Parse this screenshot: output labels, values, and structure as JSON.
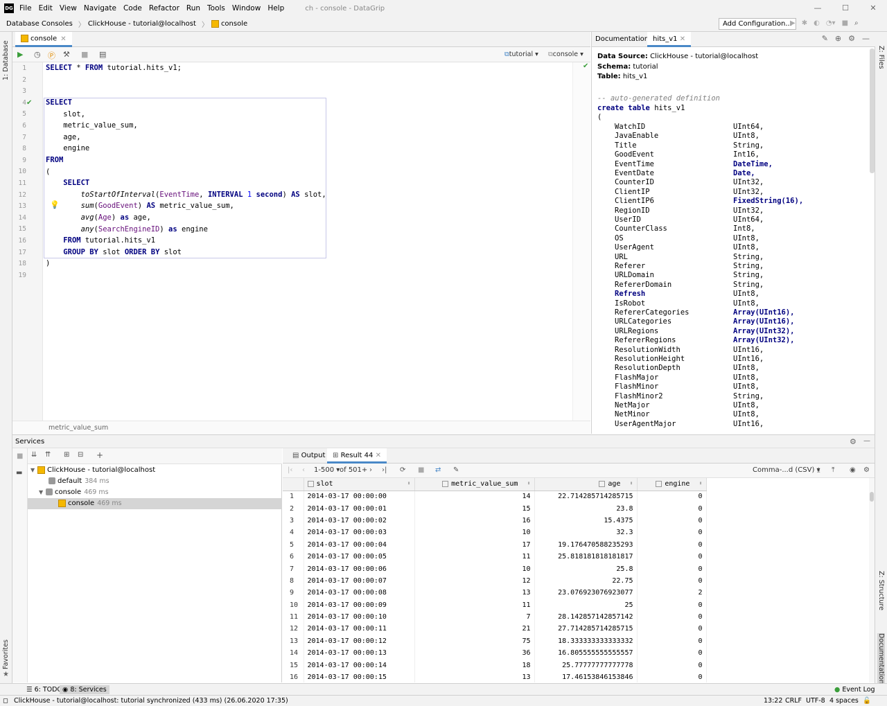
{
  "titlebar": {
    "logo": "DG",
    "menu": [
      "File",
      "Edit",
      "View",
      "Navigate",
      "Code",
      "Refactor",
      "Run",
      "Tools",
      "Window",
      "Help"
    ],
    "title": "ch - console - DataGrip"
  },
  "navbar": {
    "crumbs": [
      "Database Consoles",
      "ClickHouse - tutorial@localhost",
      "console"
    ],
    "add_config": "Add Configuration..."
  },
  "left_strip": {
    "database": "1: Database",
    "favorites": "Favorites"
  },
  "right_strip": {
    "files": "Z: Files",
    "structure": "Z: Structure",
    "documentation": "Documentation"
  },
  "editor": {
    "tab": "console",
    "schema_selector": "tutorial",
    "console_selector": "console",
    "footer": "metric_value_sum",
    "line_numbers": [
      "1",
      "2",
      "3",
      "4",
      "5",
      "6",
      "7",
      "8",
      "9",
      "10",
      "11",
      "12",
      "13",
      "14",
      "15",
      "16",
      "17",
      "18",
      "19"
    ]
  },
  "documentation": {
    "label": "Documentation:",
    "tab": "hits_v1",
    "data_source_label": "Data Source:",
    "data_source": "ClickHouse - tutorial@localhost",
    "schema_label": "Schema:",
    "schema": "tutorial",
    "table_label": "Table:",
    "table": "hits_v1",
    "comment": "-- auto-generated definition",
    "create_kw": "create table",
    "create_name": "hits_v1",
    "open_paren": "(",
    "columns": [
      {
        "name": "WatchID",
        "type": "UInt64,"
      },
      {
        "name": "JavaEnable",
        "type": "UInt8,"
      },
      {
        "name": "Title",
        "type": "String,"
      },
      {
        "name": "GoodEvent",
        "type": "Int16,"
      },
      {
        "name": "EventTime",
        "type": "DateTime,",
        "kw": true
      },
      {
        "name": "EventDate",
        "type": "Date,",
        "kw": true
      },
      {
        "name": "CounterID",
        "type": "UInt32,"
      },
      {
        "name": "ClientIP",
        "type": "UInt32,"
      },
      {
        "name": "ClientIP6",
        "type": "FixedString(16),",
        "kw": true
      },
      {
        "name": "RegionID",
        "type": "UInt32,"
      },
      {
        "name": "UserID",
        "type": "UInt64,"
      },
      {
        "name": "CounterClass",
        "type": "Int8,"
      },
      {
        "name": "OS",
        "type": "UInt8,"
      },
      {
        "name": "UserAgent",
        "type": "UInt8,"
      },
      {
        "name": "URL",
        "type": "String,"
      },
      {
        "name": "Referer",
        "type": "String,"
      },
      {
        "name": "URLDomain",
        "type": "String,"
      },
      {
        "name": "RefererDomain",
        "type": "String,"
      },
      {
        "name": "Refresh",
        "type": "UInt8,",
        "namekw": true
      },
      {
        "name": "IsRobot",
        "type": "UInt8,"
      },
      {
        "name": "RefererCategories",
        "type": "Array(UInt16),",
        "kw": true
      },
      {
        "name": "URLCategories",
        "type": "Array(UInt16),",
        "kw": true
      },
      {
        "name": "URLRegions",
        "type": "Array(UInt32),",
        "kw": true
      },
      {
        "name": "RefererRegions",
        "type": "Array(UInt32),",
        "kw": true
      },
      {
        "name": "ResolutionWidth",
        "type": "UInt16,"
      },
      {
        "name": "ResolutionHeight",
        "type": "UInt16,"
      },
      {
        "name": "ResolutionDepth",
        "type": "UInt8,"
      },
      {
        "name": "FlashMajor",
        "type": "UInt8,"
      },
      {
        "name": "FlashMinor",
        "type": "UInt8,"
      },
      {
        "name": "FlashMinor2",
        "type": "String,"
      },
      {
        "name": "NetMajor",
        "type": "UInt8,"
      },
      {
        "name": "NetMinor",
        "type": "UInt8,"
      },
      {
        "name": "UserAgentMajor",
        "type": "UInt16,"
      }
    ]
  },
  "services": {
    "title": "Services",
    "tree": [
      {
        "label": "ClickHouse - tutorial@localhost",
        "ms": ""
      },
      {
        "label": "default",
        "ms": "384 ms"
      },
      {
        "label": "console",
        "ms": "469 ms"
      },
      {
        "label": "console",
        "ms": "469 ms"
      }
    ]
  },
  "results": {
    "output_tab": "Output",
    "result_tab": "Result 44",
    "page_range": "1-500",
    "page_total": "of 501+",
    "export_format": "Comma-...d (CSV)",
    "columns": [
      "slot",
      "metric_value_sum",
      "age",
      "engine"
    ],
    "rows": [
      [
        "1",
        "2014-03-17 00:00:00",
        "14",
        "22.714285714285715",
        "0"
      ],
      [
        "2",
        "2014-03-17 00:00:01",
        "15",
        "23.8",
        "0"
      ],
      [
        "3",
        "2014-03-17 00:00:02",
        "16",
        "15.4375",
        "0"
      ],
      [
        "4",
        "2014-03-17 00:00:03",
        "10",
        "32.3",
        "0"
      ],
      [
        "5",
        "2014-03-17 00:00:04",
        "17",
        "19.176470588235293",
        "0"
      ],
      [
        "6",
        "2014-03-17 00:00:05",
        "11",
        "25.818181818181817",
        "0"
      ],
      [
        "7",
        "2014-03-17 00:00:06",
        "10",
        "25.8",
        "0"
      ],
      [
        "8",
        "2014-03-17 00:00:07",
        "12",
        "22.75",
        "0"
      ],
      [
        "9",
        "2014-03-17 00:00:08",
        "13",
        "23.076923076923077",
        "2"
      ],
      [
        "10",
        "2014-03-17 00:00:09",
        "11",
        "25",
        "0"
      ],
      [
        "11",
        "2014-03-17 00:00:10",
        "7",
        "28.142857142857142",
        "0"
      ],
      [
        "12",
        "2014-03-17 00:00:11",
        "21",
        "27.714285714285715",
        "0"
      ],
      [
        "13",
        "2014-03-17 00:00:12",
        "75",
        "18.333333333333332",
        "0"
      ],
      [
        "14",
        "2014-03-17 00:00:13",
        "36",
        "16.805555555555557",
        "0"
      ],
      [
        "15",
        "2014-03-17 00:00:14",
        "18",
        "25.77777777777778",
        "0"
      ],
      [
        "16",
        "2014-03-17 00:00:15",
        "13",
        "17.46153846153846",
        "0"
      ]
    ]
  },
  "bottom_tabs": {
    "todo": "6: TODO",
    "services": "8: Services",
    "event_log": "Event Log"
  },
  "status": {
    "message": "ClickHouse - tutorial@localhost: tutorial synchronized (433 ms) (26.06.2020 17:35)",
    "position": "13:22",
    "line_sep": "CRLF",
    "encoding": "UTF-8",
    "indent": "4 spaces"
  }
}
